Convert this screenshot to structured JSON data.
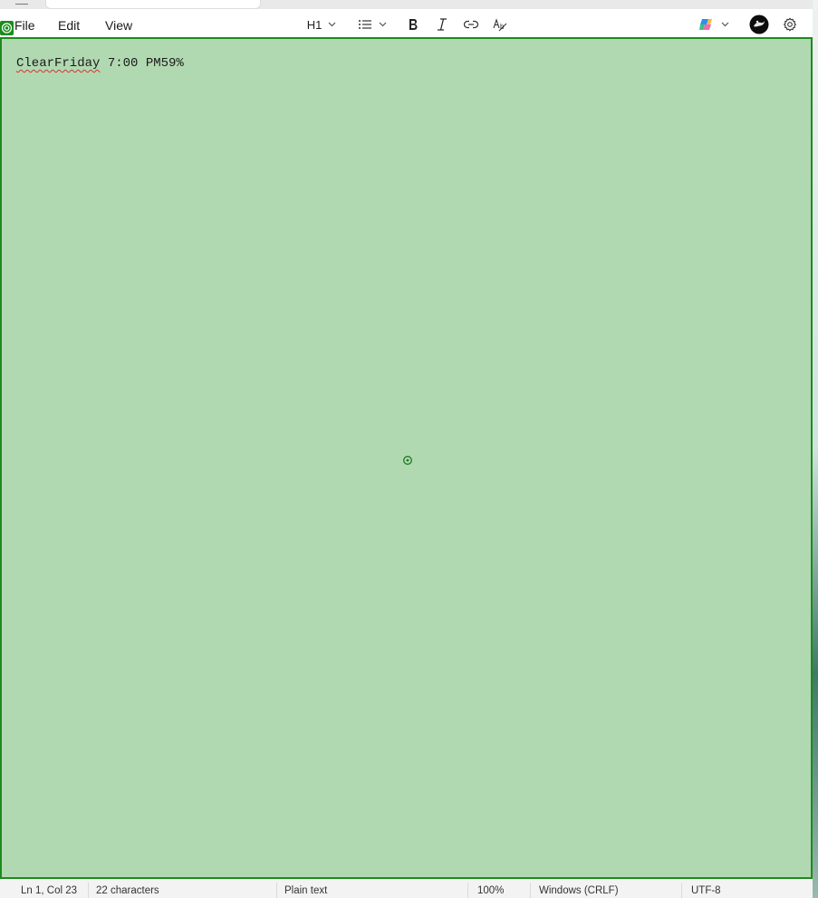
{
  "menu": {
    "file": "File",
    "edit": "Edit",
    "view": "View"
  },
  "toolbar": {
    "heading_label": "H1",
    "icons": [
      "list-icon",
      "bold-icon",
      "italic-icon",
      "link-icon",
      "clear-formatting-icon",
      "copilot-icon",
      "avatar",
      "gear-icon"
    ]
  },
  "editor": {
    "word_misspelled": "ClearFriday",
    "rest": " 7:00 PM59%"
  },
  "status": {
    "position": "Ln 1, Col 23",
    "characters": "22 characters",
    "format": "Plain text",
    "zoom": "100%",
    "line_ending": "Windows (CRLF)",
    "encoding": "UTF-8"
  },
  "colors": {
    "editor_bg": "#b1d9b1",
    "highlight_border": "#1e8a1e",
    "spell_underline": "#d13438"
  }
}
